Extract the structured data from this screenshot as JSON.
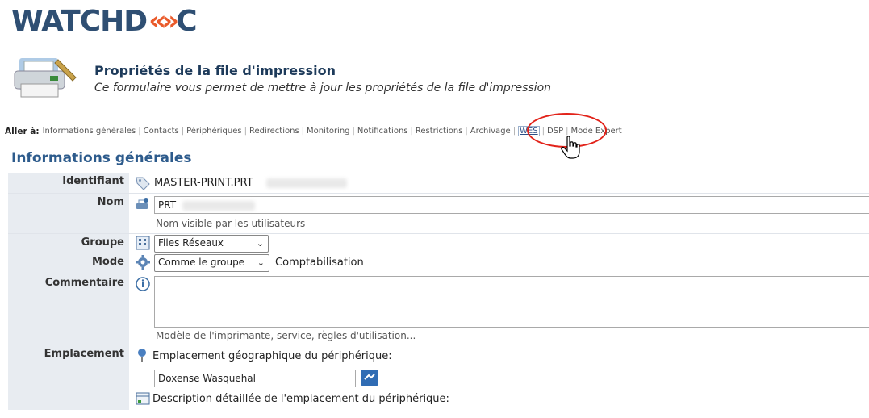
{
  "logo": {
    "part1": "WATCHD",
    "chevrons": "«»",
    "part2": "C"
  },
  "header": {
    "title": "Propriétés de la file d'impression",
    "subtitle": "Ce formulaire vous permet de mettre à jour les propriétés de la file d'impression"
  },
  "goto": {
    "label": "Aller à:",
    "links": [
      "Informations générales",
      "Contacts",
      "Périphériques",
      "Redirections",
      "Monitoring",
      "Notifications",
      "Restrictions",
      "Archivage",
      "WES",
      "DSP",
      "Mode Expert"
    ]
  },
  "section": {
    "title": "Informations générales"
  },
  "form": {
    "identifiant": {
      "label": "Identifiant",
      "value": "MASTER-PRINT.PRT"
    },
    "nom": {
      "label": "Nom",
      "value": "PRT",
      "hint": "Nom visible par les utilisateurs"
    },
    "groupe": {
      "label": "Groupe",
      "selected": "Files Réseaux"
    },
    "mode": {
      "label": "Mode",
      "selected": "Comme le groupe",
      "extra": "Comptabilisation"
    },
    "commentaire": {
      "label": "Commentaire",
      "value": "",
      "hint": "Modèle de l'imprimante, service, règles d'utilisation..."
    },
    "emplacement": {
      "label": "Emplacement",
      "geo_label": "Emplacement géographique du périphérique:",
      "geo_value": "Doxense Wasquehal",
      "desc_label": "Description détaillée de l'emplacement du périphérique:"
    }
  },
  "colors": {
    "accent": "#2d5b8c",
    "highlight_circle": "#e2231a",
    "label_bg": "#e8ecf1"
  }
}
